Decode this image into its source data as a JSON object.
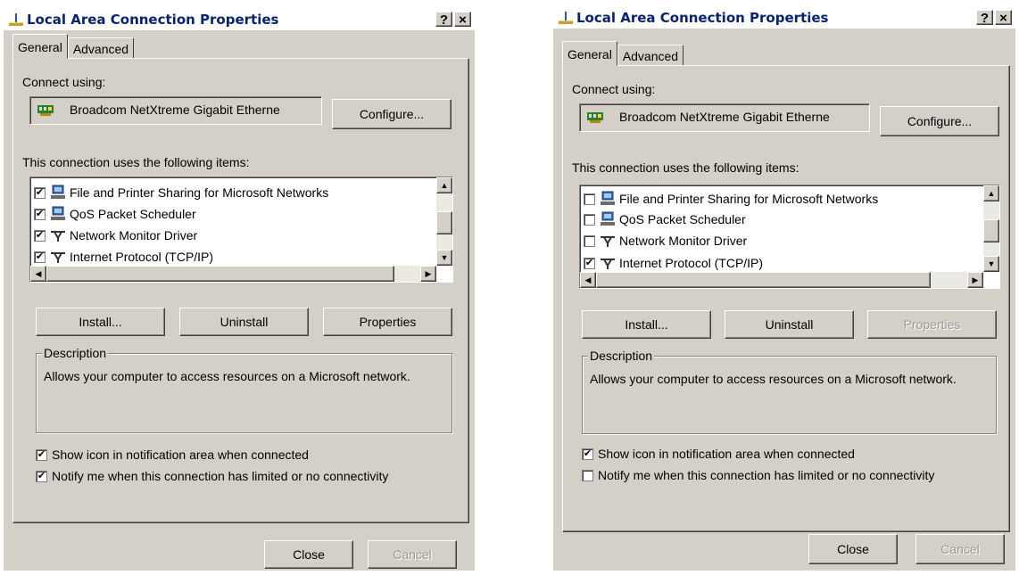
{
  "dialogs": [
    {
      "title": "Local Area Connection Properties",
      "help_button": "?",
      "close_button": "×",
      "tabs": [
        "General",
        "Advanced"
      ],
      "connect_using_label": "Connect using:",
      "adapter_name": "Broadcom NetXtreme Gigabit Etherne",
      "configure_label": "Configure...",
      "items_label": "This connection uses the following items:",
      "items": [
        {
          "label": "File and Printer Sharing for Microsoft Networks",
          "checked": true,
          "icon": "network-computer-icon"
        },
        {
          "label": "QoS Packet Scheduler",
          "checked": true,
          "icon": "network-computer-icon"
        },
        {
          "label": "Network Monitor Driver",
          "checked": true,
          "icon": "protocol-icon"
        },
        {
          "label": "Internet Protocol (TCP/IP)",
          "checked": true,
          "icon": "protocol-icon"
        }
      ],
      "install_label": "Install...",
      "uninstall_label": "Uninstall",
      "properties_label": "Properties",
      "properties_disabled": false,
      "description_label": "Description",
      "description_text": "Allows your computer to access resources on a Microsoft network.",
      "show_icon_label": "Show icon in notification area when connected",
      "show_icon_checked": true,
      "notify_label": "Notify me when this connection has limited or no connectivity",
      "notify_checked": true,
      "close_label": "Close",
      "cancel_label": "Cancel"
    },
    {
      "title": "Local Area Connection Properties",
      "help_button": "?",
      "close_button": "×",
      "tabs": [
        "General",
        "Advanced"
      ],
      "connect_using_label": "Connect using:",
      "adapter_name": "Broadcom NetXtreme Gigabit Etherne",
      "configure_label": "Configure...",
      "items_label": "This connection uses the following items:",
      "items": [
        {
          "label": "File and Printer Sharing for Microsoft Networks",
          "checked": false,
          "icon": "network-computer-icon"
        },
        {
          "label": "QoS Packet Scheduler",
          "checked": false,
          "icon": "network-computer-icon"
        },
        {
          "label": "Network Monitor Driver",
          "checked": false,
          "icon": "protocol-icon"
        },
        {
          "label": "Internet Protocol (TCP/IP)",
          "checked": true,
          "icon": "protocol-icon"
        }
      ],
      "install_label": "Install...",
      "uninstall_label": "Uninstall",
      "properties_label": "Properties",
      "properties_disabled": true,
      "description_label": "Description",
      "description_text": "Allows your computer to access resources on a Microsoft network.",
      "show_icon_label": "Show icon in notification area when connected",
      "show_icon_checked": true,
      "notify_label": "Notify me when this connection has limited or no connectivity",
      "notify_checked": false,
      "close_label": "Close",
      "cancel_label": "Cancel"
    }
  ],
  "colors": {
    "dialog_face": "#d4d0c8",
    "title_text": "#0a246a",
    "disabled_text": "#9a9a9a"
  }
}
